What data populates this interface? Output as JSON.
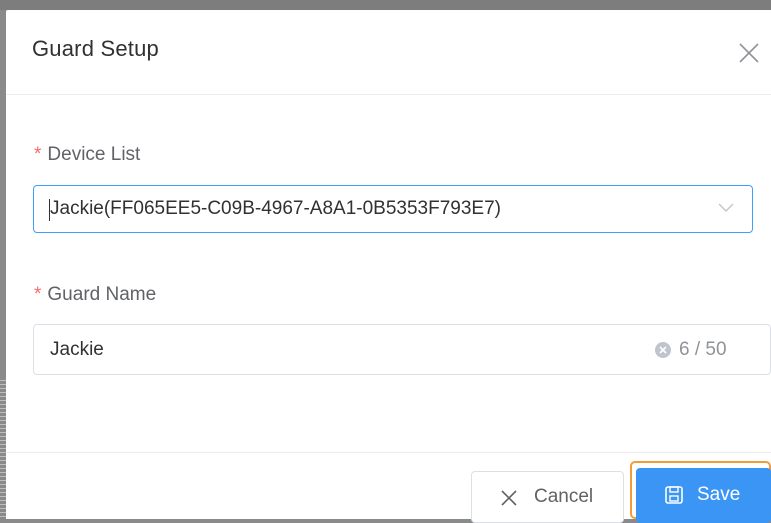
{
  "dialog": {
    "title": "Guard Setup"
  },
  "form": {
    "required_mark": "*",
    "device_list": {
      "label": "Device List",
      "value": "Jackie(FF065EE5-C09B-4967-A8A1-0B5353F793E7)"
    },
    "guard_name": {
      "label": "Guard Name",
      "value": "Jackie",
      "count": "6 / 50"
    }
  },
  "footer": {
    "cancel_label": "Cancel",
    "save_label": "Save"
  },
  "colors": {
    "primary": "#409eff",
    "save_button": "#3a95f5",
    "focus_ring": "#f39c3a",
    "required": "#f56c6c"
  },
  "icons": {
    "close": "close-icon",
    "dropdown": "chevron-down-icon",
    "clear": "clear-circle-icon",
    "cancel": "x-icon",
    "save": "save-icon"
  }
}
